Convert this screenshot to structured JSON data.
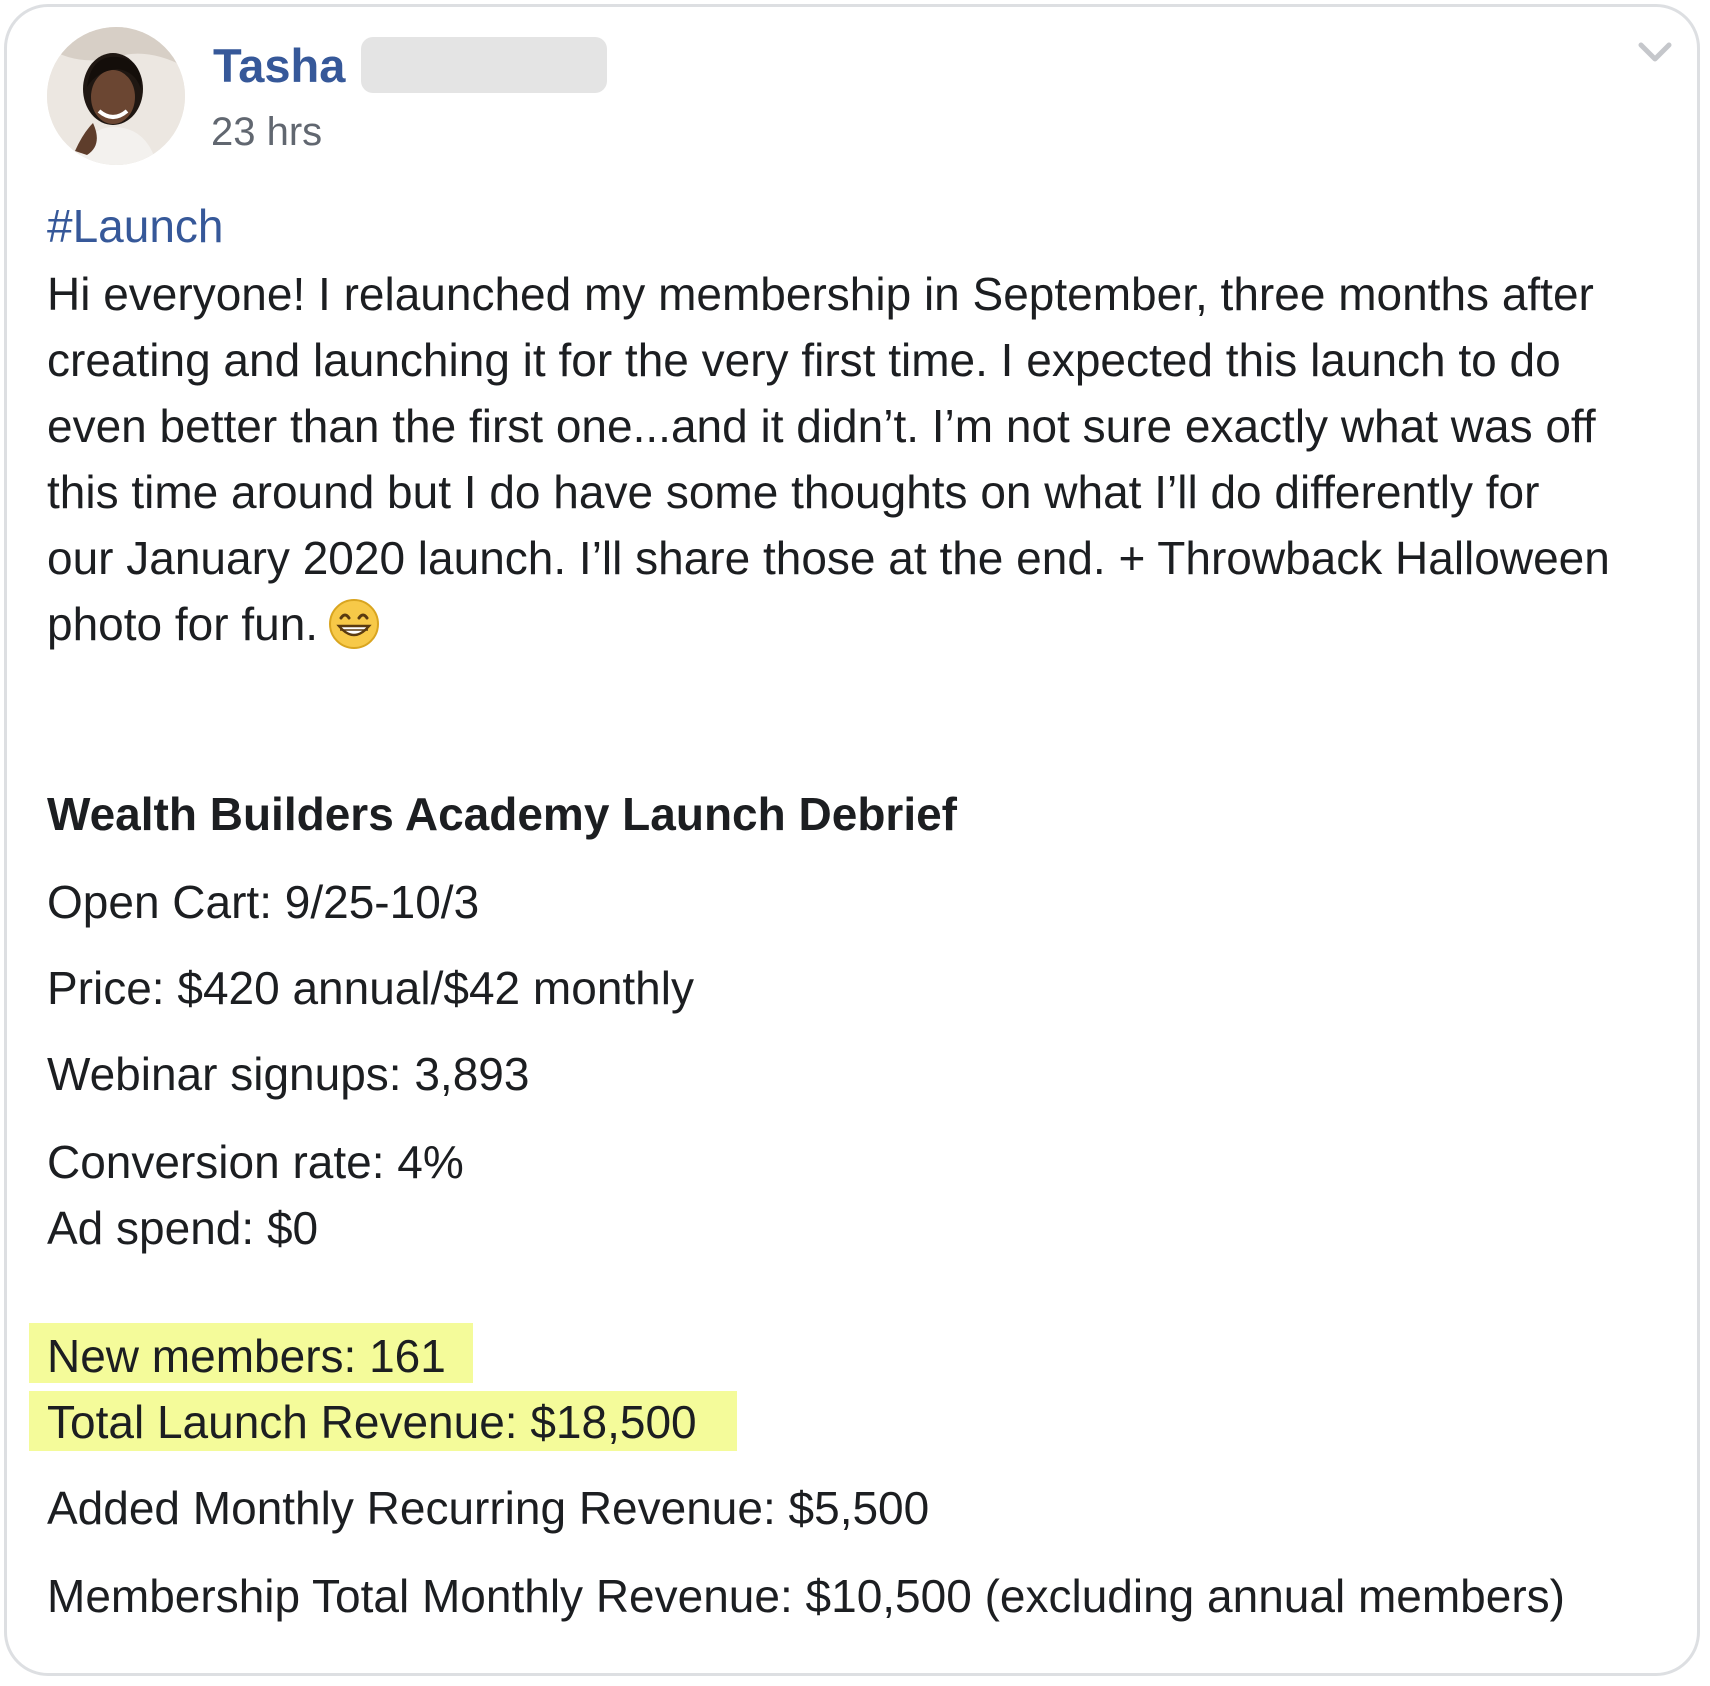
{
  "post": {
    "author": "Tasha",
    "timestamp": "23 hrs",
    "hashtag": "#Launch",
    "body_lines": [
      "Hi everyone! I relaunched my membership in September, three months after",
      "creating and launching it for the very first time. I expected this launch to do",
      "even better than the first one...and it didn’t. I’m not sure exactly what was off",
      "this time around but I do have some thoughts on what I’ll do differently for",
      "our January 2020 launch. I’ll share those at the end. + Throwback Halloween",
      "photo for fun."
    ],
    "emoji": "grinning-face-with-big-eyes-emoji",
    "debrief": {
      "title": "Wealth Builders Academy Launch Debrief",
      "open_cart": "Open Cart: 9/25-10/3",
      "price": "Price: $420 annual/$42 monthly",
      "webinar_signups": "Webinar signups: 3,893",
      "conversion_rate": "Conversion rate: 4%",
      "ad_spend": "Ad spend: $0",
      "new_members": "New members: 161",
      "total_launch_revenue": "Total Launch Revenue: $18,500",
      "added_mrr": "Added Monthly Recurring Revenue: $5,500",
      "membership_total_monthly": "Membership Total Monthly Revenue: $10,500 (excluding annual members)"
    },
    "highlight_color": "#f4fb9a",
    "link_color": "#365899"
  }
}
